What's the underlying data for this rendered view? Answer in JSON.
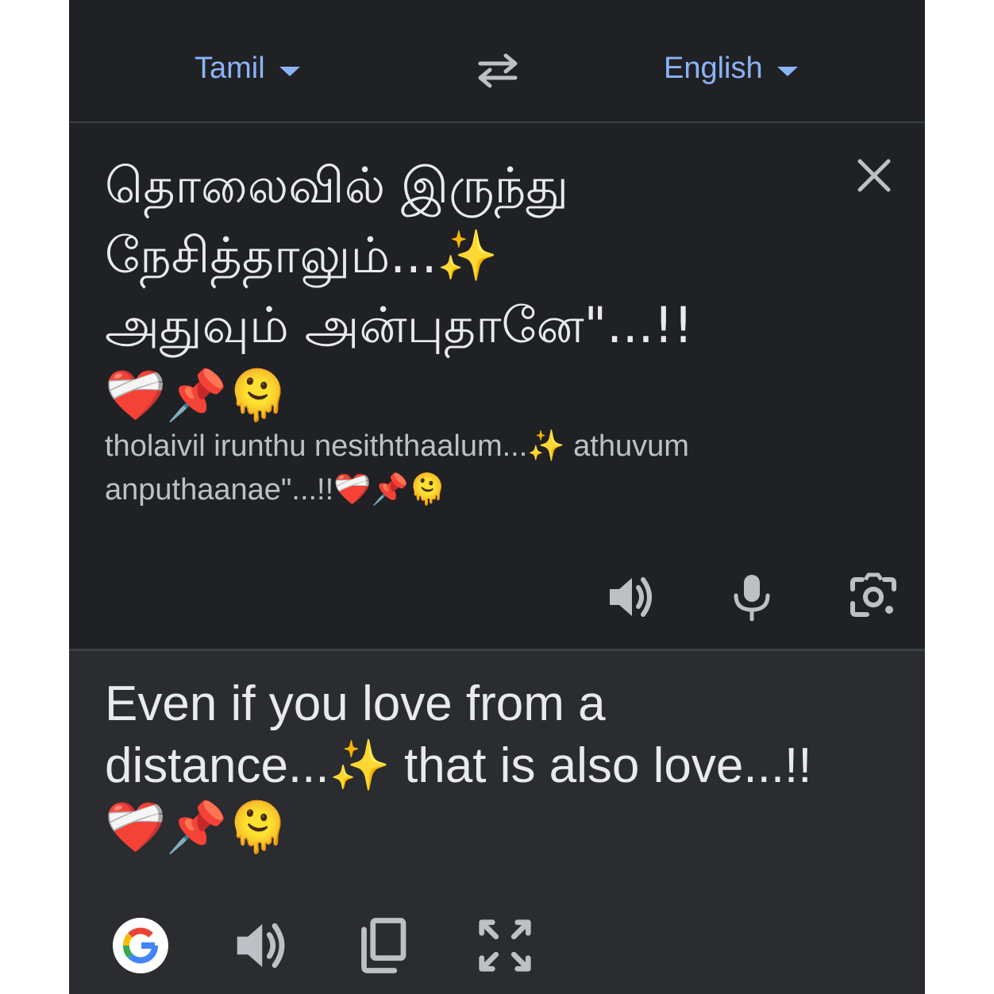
{
  "language_bar": {
    "source_language": "Tamil",
    "target_language": "English",
    "swap_icon": "swap-arrows-icon"
  },
  "source": {
    "text": "தொலைவில் இருந்து\nநேசித்தாலும்...✨\nஅதுவும் அன்புதானே\"...!!\n❤️‍🩹📌🫠",
    "transliteration": "tholaivil irunthu nesiththaalum...✨ athuvum anputhaanae\"...!!❤️‍🩹📌🫠",
    "icons": [
      "close-icon",
      "speaker-icon",
      "microphone-icon",
      "camera-icon"
    ]
  },
  "result": {
    "text": "Even if you love from a\ndistance...✨ that is also love...!!\n❤️‍🩹📌🫠",
    "icons": [
      "google-icon",
      "speaker-icon",
      "copy-icon",
      "fullscreen-icon"
    ]
  },
  "colors": {
    "background": "#202124",
    "result_background": "#2b2c2f",
    "accent": "#8ab4f8",
    "text": "#e8eaed",
    "secondary_text": "#bdc1c6",
    "icon": "#bdc1c6",
    "divider": "#3c4043"
  }
}
